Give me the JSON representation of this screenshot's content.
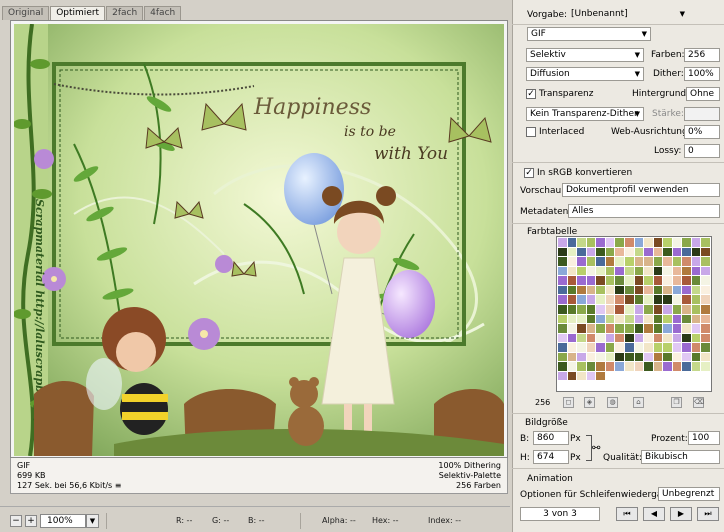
{
  "tabs": [
    "Original",
    "Optimiert",
    "2fach",
    "4fach"
  ],
  "active_tab": 1,
  "artwork": {
    "title_line1": "Happiness",
    "title_line2": "is to be",
    "title_line3": "with You",
    "side_text": "Scrapmaterial http://laluscrapblogspot.de"
  },
  "info": {
    "format": "GIF",
    "size": "699 KB",
    "time": "127 Sek. bei 56,6 Kbit/s",
    "menu_icon": "≡",
    "dithering": "100% Dithering",
    "palette": "Selektiv-Palette",
    "colors": "256 Farben"
  },
  "status": {
    "zoom": "100%",
    "r": "R: --",
    "g": "G: --",
    "b": "B: --",
    "alpha": "Alpha: --",
    "hex": "Hex: --",
    "index": "Index: --"
  },
  "settings": {
    "preset_label": "Vorgabe:",
    "preset_value": "[Unbenannt]",
    "format_value": "GIF",
    "reduction": "Selektiv",
    "colors_label": "Farben:",
    "colors_value": "256",
    "dither_algo": "Diffusion",
    "dither_label": "Dither:",
    "dither_value": "100%",
    "transparency_label": "Transparenz",
    "transparency_checked": true,
    "matte_label": "Hintergrund:",
    "matte_value": "Ohne",
    "transparency_dither": "Kein Transparenz-Dither",
    "amount_label": "Stärke:",
    "amount_value": "",
    "interlaced_label": "Interlaced",
    "interlaced_checked": false,
    "web_snap_label": "Web-Ausrichtung:",
    "web_snap_value": "0%",
    "lossy_label": "Lossy:",
    "lossy_value": "0",
    "srgb_label": "In sRGB konvertieren",
    "srgb_checked": true,
    "preview_label": "Vorschau:",
    "preview_value": "Dokumentprofil verwenden",
    "metadata_label": "Metadaten:",
    "metadata_value": "Alles"
  },
  "color_table": {
    "heading": "Farbtabelle",
    "count": "256"
  },
  "image_size": {
    "heading": "Bildgröße",
    "width_label": "B:",
    "width_value": "860",
    "height_label": "H:",
    "height_value": "674",
    "unit": "Px",
    "percent_label": "Prozent:",
    "percent_value": "100",
    "quality_label": "Qualität:",
    "quality_value": "Bikubisch"
  },
  "animation": {
    "heading": "Animation",
    "loop_label": "Optionen für Schleifenwiedergabe:",
    "loop_value": "Unbegrenzt",
    "frame_counter": "3 von 3"
  }
}
